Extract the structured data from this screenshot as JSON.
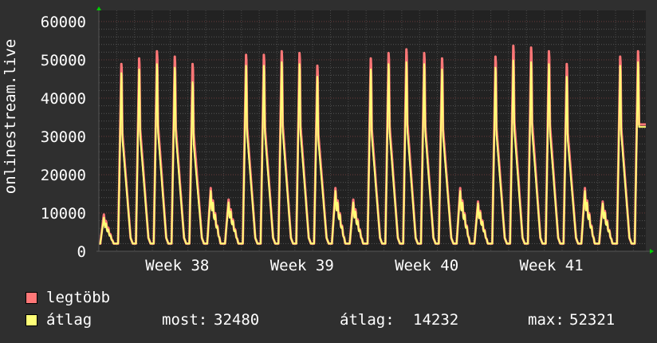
{
  "chart_data": {
    "type": "line",
    "ylabel": "onlinestream.live",
    "ylim": [
      0,
      60000
    ],
    "yticks": [
      "0",
      "10000",
      "20000",
      "30000",
      "40000",
      "50000",
      "60000"
    ],
    "xlabels": [
      {
        "label": "Week 38",
        "day": 4.4
      },
      {
        "label": "Week 39",
        "day": 11.4
      },
      {
        "label": "Week 40",
        "day": 18.4
      },
      {
        "label": "Week 41",
        "day": 25.4
      }
    ],
    "x_unit": "days",
    "xlim": [
      0,
      30.7
    ],
    "grid": true,
    "series": [
      {
        "name": "legtöbb",
        "color": "#ff7777",
        "daily_peaks": [
          9600,
          51500,
          53000,
          55000,
          53500,
          51500,
          16500,
          13500,
          54000,
          54000,
          55000,
          54500,
          51000,
          16500,
          13500,
          53000,
          54500,
          55500,
          54500,
          53000,
          16500,
          13000,
          53500,
          56500,
          56000,
          55000,
          51500,
          16500,
          13000,
          53500,
          55000
        ]
      },
      {
        "name": "átlag",
        "color": "#ffff77",
        "daily_peaks": [
          8800,
          49000,
          50000,
          51500,
          50500,
          46500,
          15800,
          12800,
          51000,
          51000,
          52000,
          51500,
          48000,
          15800,
          12800,
          50000,
          51500,
          52000,
          51500,
          50000,
          15800,
          12500,
          50500,
          52500,
          52000,
          51500,
          48000,
          15800,
          12500,
          51000,
          52000
        ]
      }
    ],
    "last_value": 32480,
    "legend": [
      {
        "name": "legtöbb",
        "color": "#ff7777"
      },
      {
        "name": "átlag",
        "color": "#ffff77",
        "stats": {
          "now_label": "most:",
          "now": "32480",
          "avg_label": "átlag:",
          "avg": "14232",
          "max_label": "max:",
          "max": "52321"
        }
      }
    ]
  }
}
